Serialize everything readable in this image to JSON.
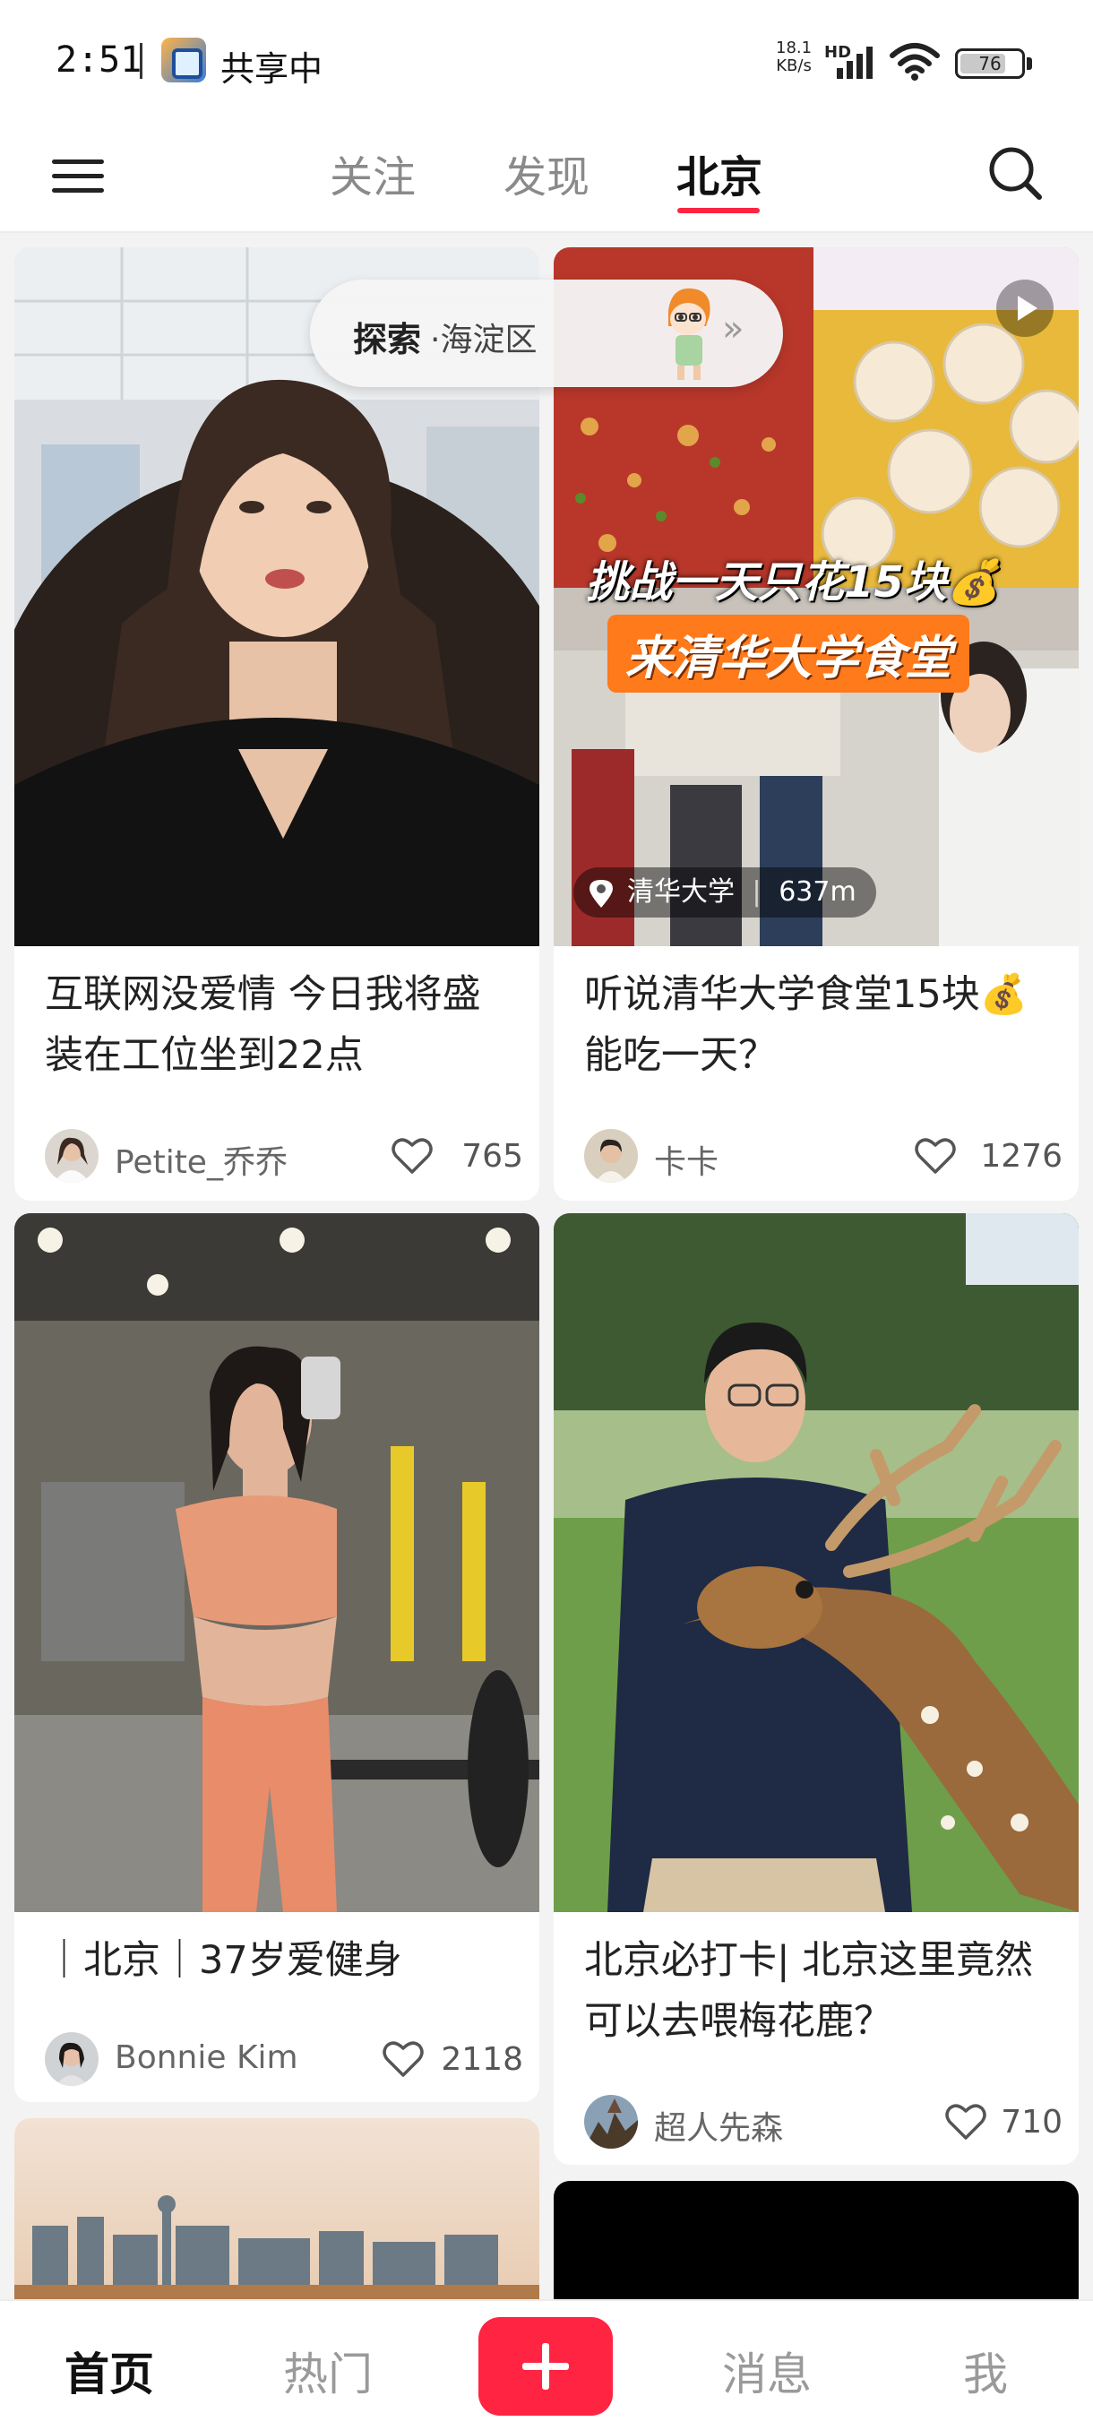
{
  "status": {
    "time": "2:51",
    "sharing": "共享中",
    "net_speed": "18.1",
    "net_unit": "KB/s",
    "network": "HD",
    "battery": "76"
  },
  "nav": {
    "tabs": [
      "关注",
      "发现",
      "北京"
    ],
    "active_tab": "北京"
  },
  "explore": {
    "label": "探索",
    "district": "·海淀区"
  },
  "feed": [
    {
      "title": "互联网没爱情 今日我将盛装在工位坐到22点",
      "author": "Petite_乔乔",
      "likes": "765"
    },
    {
      "title": "听说清华大学食堂15块💰能吃一天？",
      "author": "卡卡",
      "likes": "1276",
      "video": true,
      "headline_1": "挑战一天只花15块💰",
      "headline_2": "来清华大学食堂",
      "location": "清华大学",
      "distance": "637m"
    },
    {
      "title": "｜北京｜37岁爱健身",
      "author": "Bonnie Kim",
      "likes": "2118"
    },
    {
      "title": "北京必打卡| 北京这里竟然可以去喂梅花鹿？",
      "author": "超人先森",
      "likes": "710"
    }
  ],
  "bottom_nav": {
    "home": "首页",
    "hot": "热门",
    "messages": "消息",
    "me": "我"
  },
  "colors": {
    "accent": "#ff2442",
    "background": "#f3f3f3"
  }
}
